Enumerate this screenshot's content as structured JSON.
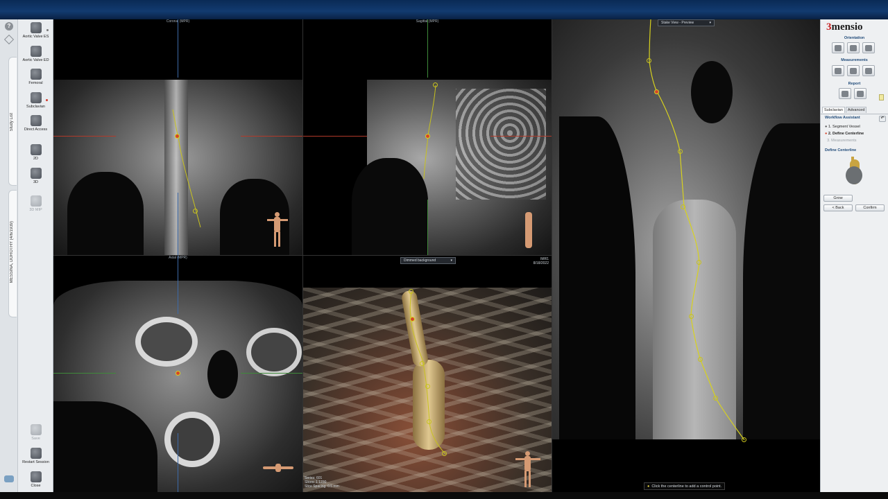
{
  "app": {
    "logo_prefix": "3",
    "logo_rest": "mensio"
  },
  "left_toolbar": {
    "help_icon": "?",
    "study_list_tab": "Study List",
    "patient_tab": "MESSINA, DOROTHY (4/6/1939)",
    "tools": [
      {
        "label": "Aortic Valve ES"
      },
      {
        "label": "Aortic Valve ED"
      },
      {
        "label": "Femoral"
      },
      {
        "label": "Subclavian"
      },
      {
        "label": "Direct Access"
      },
      {
        "label": "2D"
      },
      {
        "label": "3D"
      },
      {
        "label": "3D MIP"
      }
    ],
    "bottom_tools": [
      {
        "label": "Save"
      },
      {
        "label": "Restart Session"
      },
      {
        "label": "Close"
      }
    ]
  },
  "viewports": {
    "coronal": {
      "title": "Coronal (MPR)"
    },
    "sagittal": {
      "title": "Sagittal (MPR)"
    },
    "axial": {
      "title": "Axial (MPR)"
    },
    "render3d": {
      "dropdown": "Dimmed background",
      "info_right_line1": "IMR1",
      "info_right_line2": "8/18/2022",
      "info_left": [
        "Series: 601",
        "Slices: 1 1230",
        "Slice Spacing: 0.5 mm"
      ]
    },
    "stake": {
      "dropdown": "Stake View - Preview"
    }
  },
  "right_panel": {
    "orientation": "Orientation",
    "measurements": "Measurements",
    "report": "Report",
    "tabs": [
      "Subclavian",
      "Advanced"
    ],
    "workflow_title": "Workflow Assistant",
    "steps": [
      "1. Segment Vessel",
      "2. Define Centerline",
      "3. Measurements"
    ],
    "define_title": "Define Centerline",
    "grow_button": "Grow",
    "back_button": "< Back",
    "confirm_button": "Confirm"
  },
  "status": {
    "hint": "Click the centerline to add a control point."
  },
  "colors": {
    "accent_red": "#d4452a",
    "centerline_yellow": "#d8d21e",
    "topbar": "#123b70"
  }
}
